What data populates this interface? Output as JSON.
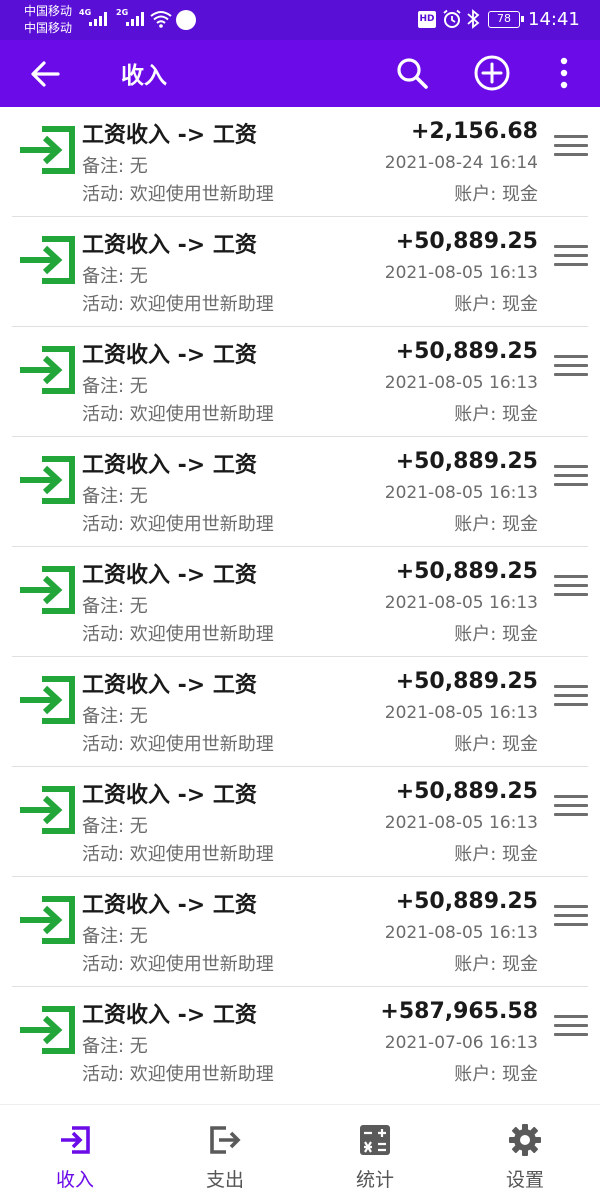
{
  "status_bar": {
    "carrier_1": "中国移动",
    "carrier_2": "中国移动",
    "net_1": "4G",
    "net_2": "2G",
    "hd": "HD",
    "battery": "78",
    "time": "14:41"
  },
  "app_bar": {
    "title": "收入",
    "background": "#6a0be8"
  },
  "colors": {
    "accent": "#6a0be8",
    "income_icon": "#22a63a"
  },
  "records": [
    {
      "title": "工资收入 -> 工资",
      "note": "备注: 无",
      "activity": "活动: 欢迎使用世新助理",
      "amount": "+2,156.68",
      "date": "2021-08-24 16:14",
      "account": "账户: 现金"
    },
    {
      "title": "工资收入 -> 工资",
      "note": "备注: 无",
      "activity": "活动: 欢迎使用世新助理",
      "amount": "+50,889.25",
      "date": "2021-08-05 16:13",
      "account": "账户: 现金"
    },
    {
      "title": "工资收入 -> 工资",
      "note": "备注: 无",
      "activity": "活动: 欢迎使用世新助理",
      "amount": "+50,889.25",
      "date": "2021-08-05 16:13",
      "account": "账户: 现金"
    },
    {
      "title": "工资收入 -> 工资",
      "note": "备注: 无",
      "activity": "活动: 欢迎使用世新助理",
      "amount": "+50,889.25",
      "date": "2021-08-05 16:13",
      "account": "账户: 现金"
    },
    {
      "title": "工资收入 -> 工资",
      "note": "备注: 无",
      "activity": "活动: 欢迎使用世新助理",
      "amount": "+50,889.25",
      "date": "2021-08-05 16:13",
      "account": "账户: 现金"
    },
    {
      "title": "工资收入 -> 工资",
      "note": "备注: 无",
      "activity": "活动: 欢迎使用世新助理",
      "amount": "+50,889.25",
      "date": "2021-08-05 16:13",
      "account": "账户: 现金"
    },
    {
      "title": "工资收入 -> 工资",
      "note": "备注: 无",
      "activity": "活动: 欢迎使用世新助理",
      "amount": "+50,889.25",
      "date": "2021-08-05 16:13",
      "account": "账户: 现金"
    },
    {
      "title": "工资收入 -> 工资",
      "note": "备注: 无",
      "activity": "活动: 欢迎使用世新助理",
      "amount": "+50,889.25",
      "date": "2021-08-05 16:13",
      "account": "账户: 现金"
    },
    {
      "title": "工资收入 -> 工资",
      "note": "备注: 无",
      "activity": "活动: 欢迎使用世新助理",
      "amount": "+587,965.58",
      "date": "2021-07-06 16:13",
      "account": "账户: 现金"
    }
  ],
  "bottom_nav": [
    {
      "label": "收入",
      "icon": "income-icon",
      "active": true
    },
    {
      "label": "支出",
      "icon": "expense-icon",
      "active": false
    },
    {
      "label": "统计",
      "icon": "calculator-icon",
      "active": false
    },
    {
      "label": "设置",
      "icon": "gear-icon",
      "active": false
    }
  ]
}
